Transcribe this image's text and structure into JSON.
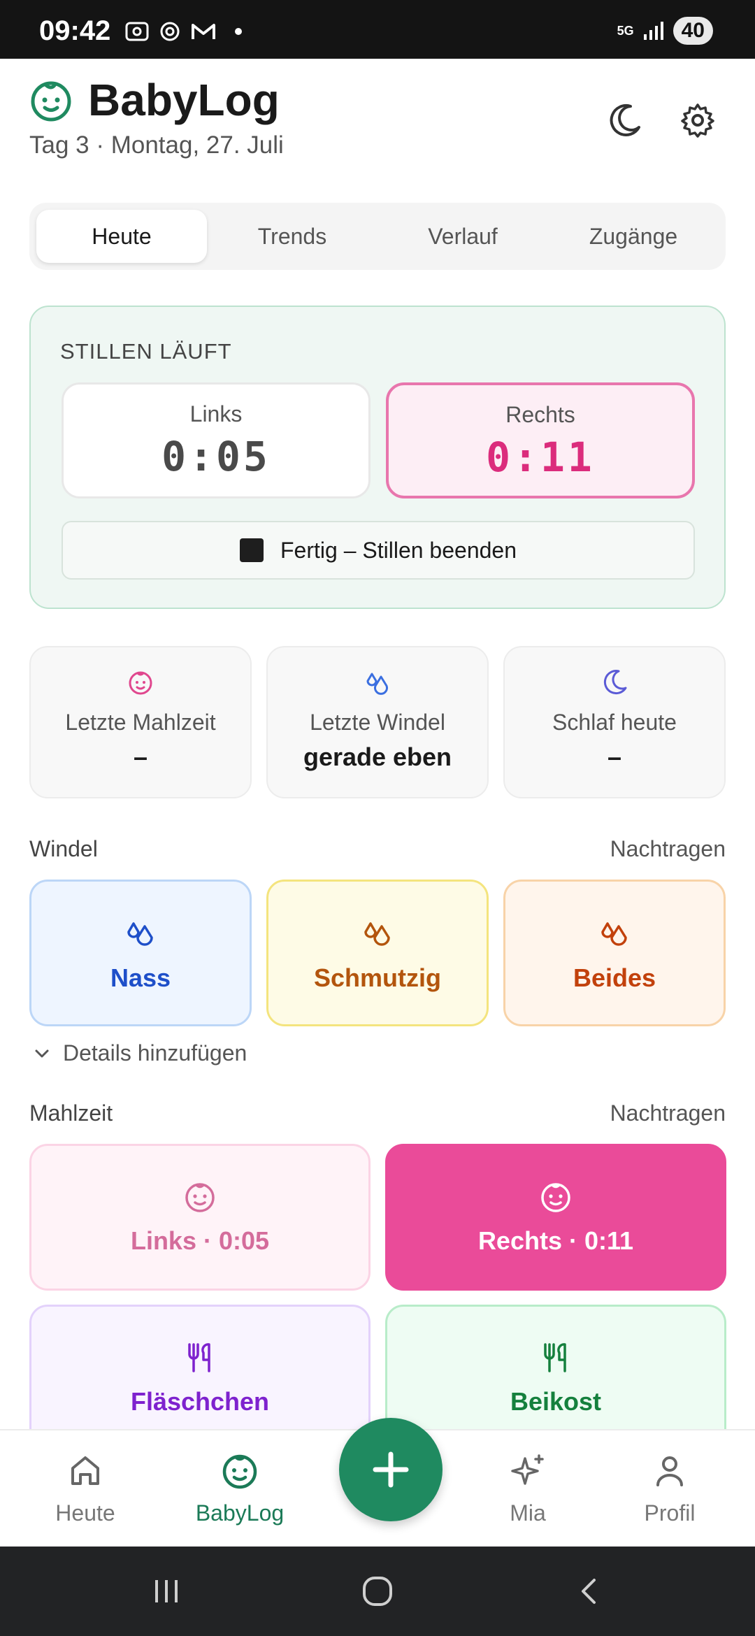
{
  "status_bar": {
    "time": "09:42",
    "network": "5G",
    "battery": "40"
  },
  "header": {
    "title": "BabyLog",
    "subtitle": "Tag 3 · Montag, 27. Juli",
    "icons": [
      "baby-face-icon",
      "moon-icon",
      "gear-icon"
    ]
  },
  "tabs": [
    {
      "label": "Heute",
      "active": true
    },
    {
      "label": "Trends",
      "active": false
    },
    {
      "label": "Verlauf",
      "active": false
    },
    {
      "label": "Zugänge",
      "active": false
    }
  ],
  "running": {
    "title": "STILLEN LÄUFT",
    "left": {
      "label": "Links",
      "time": "0:05"
    },
    "right": {
      "label": "Rechts",
      "time": "0:11"
    },
    "finish_label": "Fertig – Stillen beenden"
  },
  "stats": [
    {
      "label": "Letzte Mahlzeit",
      "value": "–",
      "icon": "baby-face-icon"
    },
    {
      "label": "Letzte Windel",
      "value": "gerade eben",
      "icon": "drops-icon"
    },
    {
      "label": "Schlaf heute",
      "value": "–",
      "icon": "moon-icon"
    }
  ],
  "diaper": {
    "title": "Windel",
    "link": "Nachtragen",
    "buttons": [
      {
        "label": "Nass",
        "color": "#1e4fc9"
      },
      {
        "label": "Schmutzig",
        "color": "#b3550d"
      },
      {
        "label": "Beides",
        "color": "#c2410c"
      }
    ],
    "details_label": "Details hinzufügen"
  },
  "meal": {
    "title": "Mahlzeit",
    "link": "Nachtragen",
    "buttons": [
      {
        "label": "Links · 0:05"
      },
      {
        "label": "Rechts · 0:11"
      },
      {
        "label": "Fläschchen"
      },
      {
        "label": "Beikost"
      }
    ]
  },
  "bottom_nav": [
    {
      "label": "Heute",
      "icon": "home-icon"
    },
    {
      "label": "BabyLog",
      "icon": "baby-face-icon",
      "active": true
    },
    {
      "label": "Mia",
      "icon": "sparkle-icon"
    },
    {
      "label": "Profil",
      "icon": "person-icon"
    }
  ],
  "colors": {
    "brand": "#1f8a60",
    "accent_pink": "#ea4b99"
  }
}
